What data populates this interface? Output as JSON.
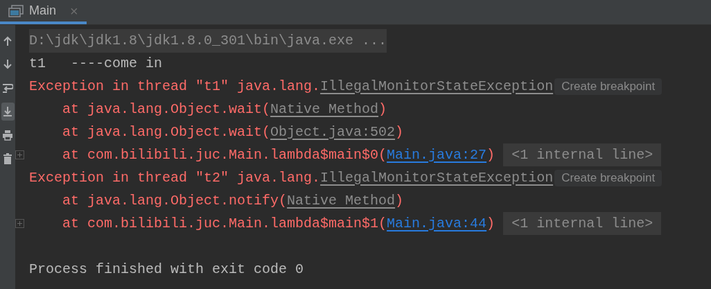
{
  "tabs": [
    {
      "label": "Main",
      "close": "×",
      "selected": true
    }
  ],
  "toolbar": [
    {
      "kind": "up",
      "selected": false
    },
    {
      "kind": "down",
      "selected": false
    },
    {
      "kind": "wrap",
      "selected": false
    },
    {
      "kind": "scroll-end",
      "selected": true
    },
    {
      "kind": "print",
      "selected": false
    },
    {
      "kind": "trash",
      "selected": false
    }
  ],
  "console": [
    {
      "kind": "command",
      "segments": [
        {
          "kind": "text",
          "text": "D:\\jdk\\jdk1.8\\jdk1.8.0_301\\bin\\java.exe ..."
        }
      ]
    },
    {
      "kind": "output",
      "segments": [
        {
          "kind": "text",
          "text": "t1   ----come in"
        }
      ]
    },
    {
      "kind": "error",
      "segments": [
        {
          "kind": "text",
          "text": "Exception in thread \"t1\" java.lang."
        },
        {
          "kind": "class-link",
          "text": "IllegalMonitorStateException"
        },
        {
          "kind": "hint",
          "text": "Create breakpoint"
        }
      ]
    },
    {
      "kind": "stack-frame",
      "segments": [
        {
          "kind": "text",
          "text": "at java.lang.Object.wait("
        },
        {
          "kind": "class-link",
          "text": "Native Method"
        },
        {
          "kind": "text",
          "text": ")"
        }
      ]
    },
    {
      "kind": "stack-frame",
      "segments": [
        {
          "kind": "text",
          "text": "at java.lang.Object.wait("
        },
        {
          "kind": "class-link",
          "text": "Object.java:502"
        },
        {
          "kind": "text",
          "text": ")"
        }
      ]
    },
    {
      "kind": "stack-frame",
      "foldable": true,
      "segments": [
        {
          "kind": "text",
          "text": "at com.bilibili.juc.Main.lambda$main$0("
        },
        {
          "kind": "source-link",
          "text": "Main.java:27"
        },
        {
          "kind": "text",
          "text": ")"
        },
        {
          "kind": "collapsed",
          "text": "<1 internal line>"
        }
      ]
    },
    {
      "kind": "error",
      "segments": [
        {
          "kind": "text",
          "text": "Exception in thread \"t2\" java.lang."
        },
        {
          "kind": "class-link",
          "text": "IllegalMonitorStateException"
        },
        {
          "kind": "hint",
          "text": "Create breakpoint"
        }
      ]
    },
    {
      "kind": "stack-frame",
      "segments": [
        {
          "kind": "text",
          "text": "at java.lang.Object.notify("
        },
        {
          "kind": "class-link",
          "text": "Native Method"
        },
        {
          "kind": "text",
          "text": ")"
        }
      ]
    },
    {
      "kind": "stack-frame",
      "foldable": true,
      "segments": [
        {
          "kind": "text",
          "text": "at com.bilibili.juc.Main.lambda$main$1("
        },
        {
          "kind": "source-link",
          "text": "Main.java:44"
        },
        {
          "kind": "text",
          "text": ")"
        },
        {
          "kind": "collapsed",
          "text": "<1 internal line>"
        }
      ]
    },
    {
      "kind": "blank"
    },
    {
      "kind": "output",
      "segments": [
        {
          "kind": "text",
          "text": "Process finished with exit code 0"
        }
      ]
    }
  ]
}
